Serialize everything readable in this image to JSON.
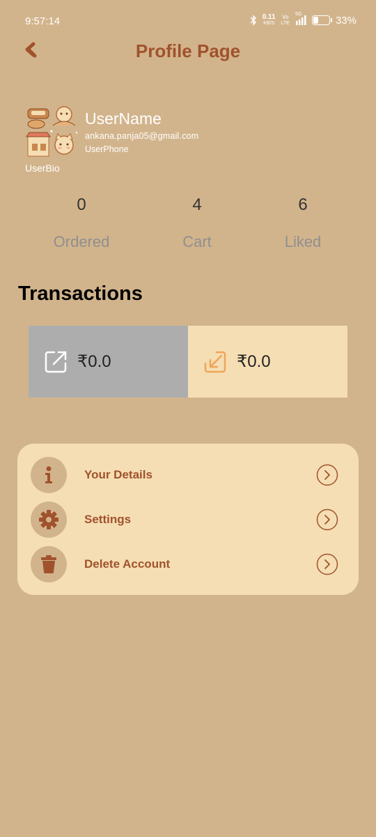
{
  "status_bar": {
    "time": "9:57:14",
    "network_speed_value": "0.11",
    "network_speed_unit": "KB/S",
    "volte_label_top": "Vo",
    "volte_label_bottom": "LTE",
    "signal_label": "5G",
    "battery_percent": "33%",
    "battery_level": 0.33
  },
  "header": {
    "title": "Profile Page"
  },
  "profile": {
    "name": "UserName",
    "email": "ankana.panja05@gmail.com",
    "phone": "UserPhone",
    "bio": "UserBio"
  },
  "stats": [
    {
      "value": "0",
      "label": "Ordered"
    },
    {
      "value": "4",
      "label": "Cart"
    },
    {
      "value": "6",
      "label": "Liked"
    }
  ],
  "transactions": {
    "title": "Transactions",
    "outgoing_amount": "₹0.0",
    "incoming_amount": "₹0.0"
  },
  "menu": {
    "items": [
      {
        "label": "Your Details",
        "icon": "info-icon"
      },
      {
        "label": "Settings",
        "icon": "gear-icon"
      },
      {
        "label": "Delete Account",
        "icon": "trash-icon"
      }
    ]
  },
  "colors": {
    "background": "#D2B48C",
    "accent": "#A0522D",
    "card": "#F5DEB3",
    "outgoing_card": "#ADADAD",
    "incoming_icon": "#F0A45A"
  }
}
